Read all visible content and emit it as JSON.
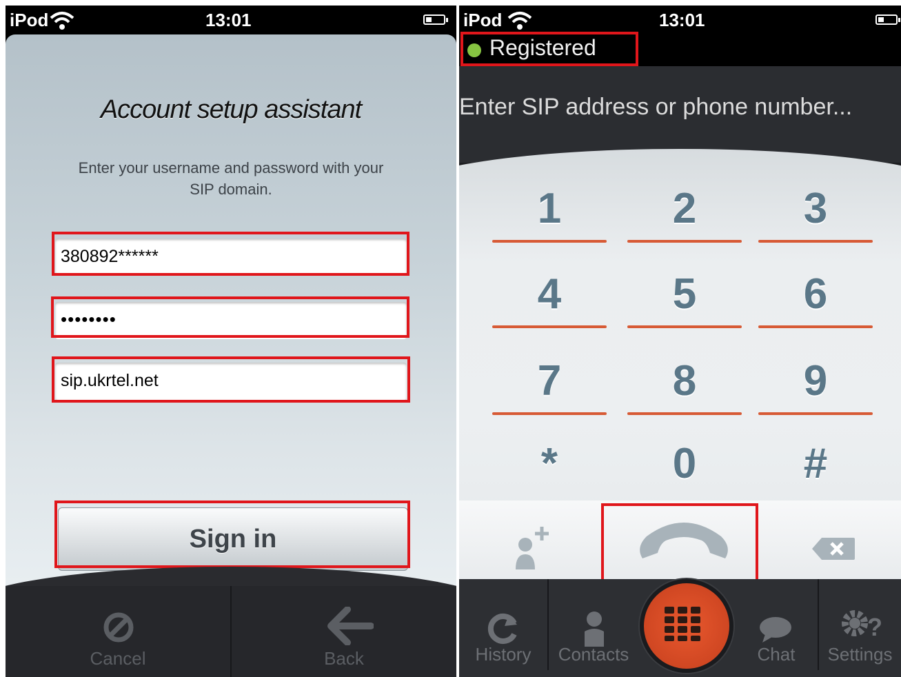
{
  "left": {
    "status": {
      "carrier": "iPod",
      "time": "13:01"
    },
    "title": "Account setup assistant",
    "description": "Enter your username and password with your SIP domain.",
    "username_value": "380892******",
    "password_value": "••••••••",
    "domain_value": "sip.ukrtel.net",
    "sign_in_label": "Sign in",
    "tabs": {
      "cancel": "Cancel",
      "back": "Back"
    }
  },
  "right": {
    "status": {
      "carrier": "iPod",
      "time": "13:01"
    },
    "registration": "Registered",
    "address_placeholder": "Enter SIP address or phone number...",
    "keys": [
      "1",
      "2",
      "3",
      "4",
      "5",
      "6",
      "7",
      "8",
      "9",
      "*",
      "0",
      "#"
    ],
    "tabs": {
      "history": "History",
      "contacts": "Contacts",
      "chat": "Chat",
      "settings": "Settings"
    }
  },
  "colors": {
    "accent": "#d75a35",
    "highlight": "#e0161b",
    "registered": "#87c442"
  }
}
